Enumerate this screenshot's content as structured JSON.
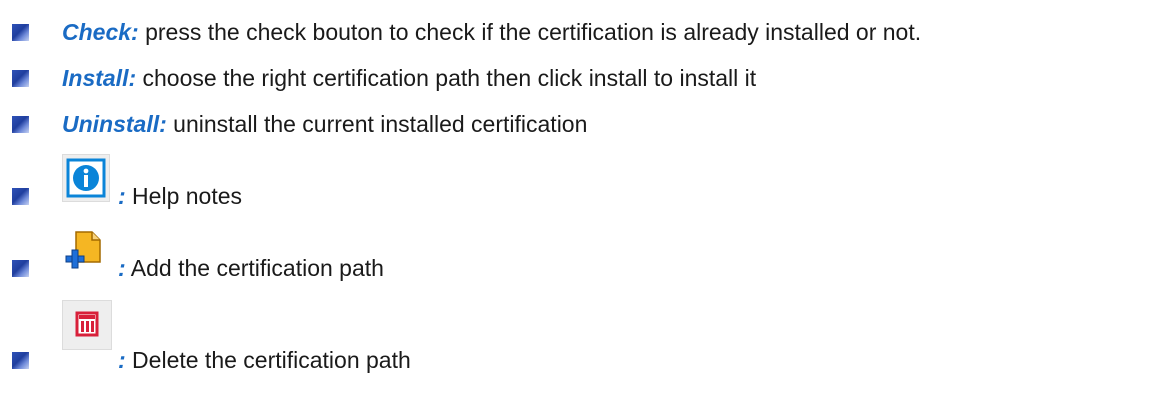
{
  "items": [
    {
      "keyword": "Check:",
      "text": " press the check bouton to check if the certification is already installed or not."
    },
    {
      "keyword": "Install:",
      "text": " choose the right certification path then click install to install it"
    },
    {
      "keyword": "Uninstall:",
      "text": " uninstall the current installed certification"
    },
    {
      "icon": "info-icon",
      "colon": ":",
      "text": " Help notes"
    },
    {
      "icon": "add-document-icon",
      "colon": ":",
      "text": " Add the certification path"
    },
    {
      "icon": "delete-trash-icon",
      "colon": ":",
      "text": " Delete the certification path"
    }
  ],
  "colors": {
    "keyword": "#1a6bc4",
    "bullet": "#2f52b8",
    "info_icon": "#0a84d8",
    "add_icon_folder": "#f5b623",
    "add_icon_plus": "#1e6fd9",
    "delete_icon": "#d8203a"
  }
}
